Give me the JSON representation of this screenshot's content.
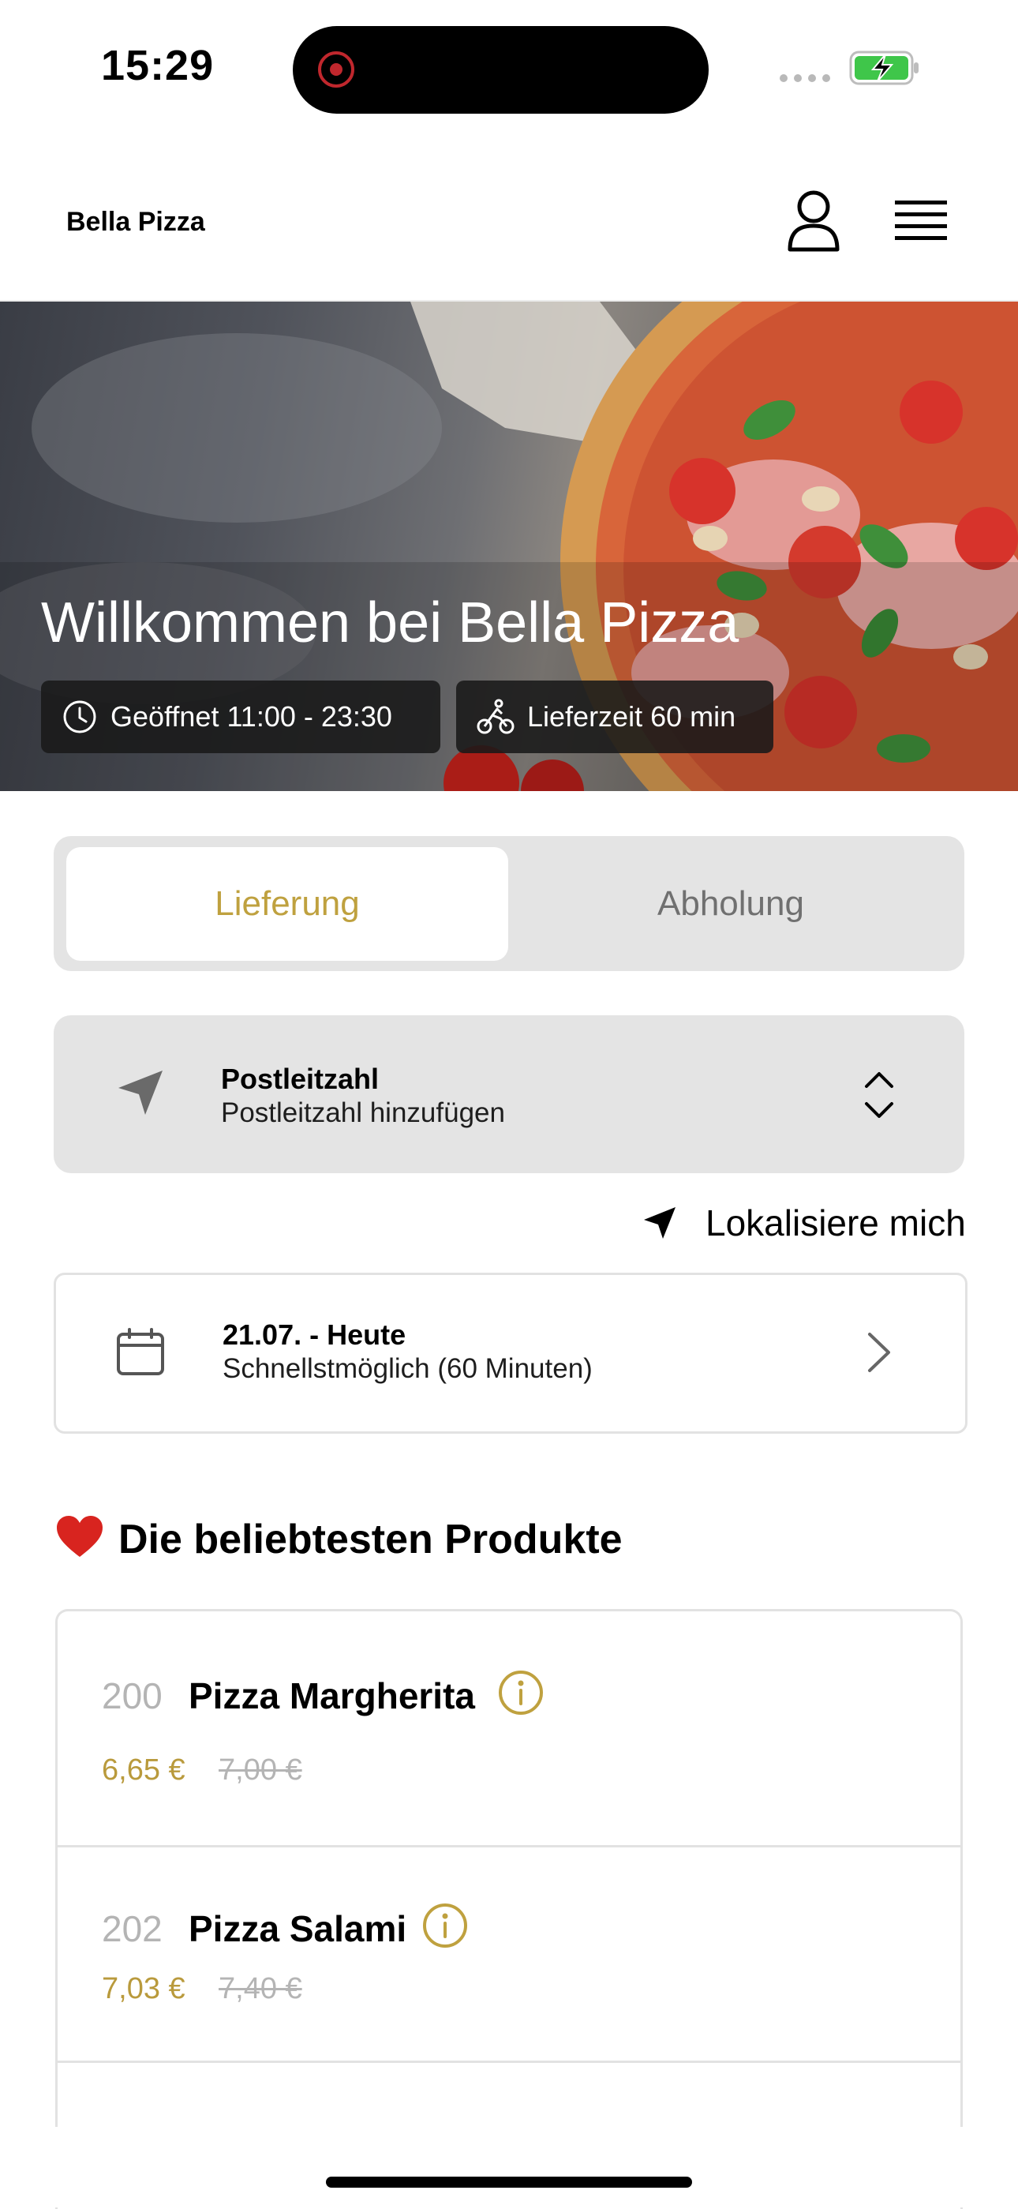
{
  "status_bar": {
    "time": "15:29",
    "battery": "charging"
  },
  "header": {
    "brand": "Bella Pizza",
    "icons": [
      "user-icon",
      "menu-icon"
    ]
  },
  "hero": {
    "title": "Willkommen bei Bella Pizza",
    "opening_hours": "Geöffnet 11:00 - 23:30",
    "delivery_time": "Lieferzeit 60 min"
  },
  "mode_toggle": {
    "active": "Lieferung",
    "inactive": "Abholung"
  },
  "postcode": {
    "title": "Postleitzahl",
    "placeholder": "Postleitzahl hinzufügen"
  },
  "locate": {
    "label": "Lokalisiere mich"
  },
  "date": {
    "title": "21.07. - Heute",
    "subtitle": "Schnellstmöglich (60 Minuten)"
  },
  "popular": {
    "title": "Die beliebtesten Produkte",
    "products": [
      {
        "number": "200",
        "name": "Pizza Margherita",
        "price": "6,65 €",
        "old_price": "7,00 €"
      },
      {
        "number": "202",
        "name": "Pizza Salami",
        "price": "7,03 €",
        "old_price": "7,40 €"
      }
    ]
  },
  "colors": {
    "accent": "#bfa13f",
    "segment_bg": "#e4e4e4",
    "muted": "#b4b4b4"
  }
}
